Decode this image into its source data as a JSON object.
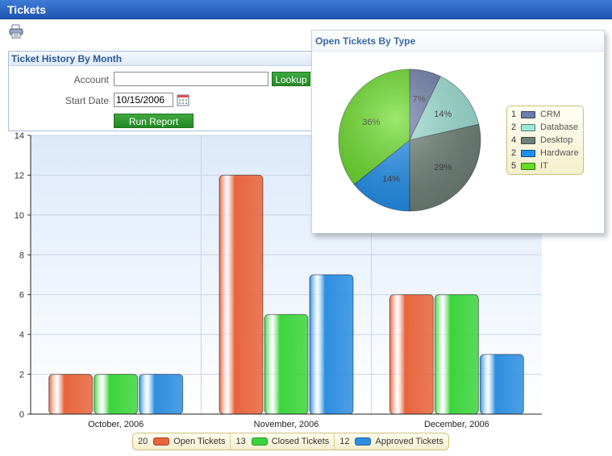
{
  "window": {
    "title": "Tickets"
  },
  "toolbar": {
    "print_icon": "printer-icon"
  },
  "history_panel": {
    "title": "Ticket History By Month",
    "account_label": "Account",
    "account_value": "",
    "lookup_label": "Lookup",
    "start_date_label": "Start Date",
    "start_date_value": "10/15/2006",
    "calendar_icon": "calendar-icon",
    "run_label": "Run Report"
  },
  "chart_data": [
    {
      "type": "bar",
      "categories": [
        "October, 2006",
        "November, 2006",
        "December, 2006"
      ],
      "series": [
        {
          "name": "Open Tickets",
          "values": [
            2,
            12,
            6
          ],
          "color": "#e8643c",
          "total": "20"
        },
        {
          "name": "Closed Tickets",
          "values": [
            2,
            5,
            6
          ],
          "color": "#3cd43c",
          "total": "13"
        },
        {
          "name": "Approved Tickets",
          "values": [
            2,
            7,
            3
          ],
          "color": "#2e8ee0",
          "total": "12"
        }
      ],
      "ylim": [
        0,
        14
      ],
      "yticks": [
        "0",
        "2",
        "4",
        "6",
        "8",
        "10",
        "12",
        "14"
      ],
      "grid": true,
      "legend_position": "bottom"
    },
    {
      "type": "pie",
      "title": "Open Tickets By Type",
      "slices": [
        {
          "label": "CRM",
          "count": "1",
          "value": 1,
          "pct": "7%",
          "color": "#6b7da8"
        },
        {
          "label": "Database",
          "count": "2",
          "value": 2,
          "pct": "14%",
          "color": "#9ee4d8"
        },
        {
          "label": "Desktop",
          "count": "4",
          "value": 4,
          "pct": "29%",
          "color": "#6f827a"
        },
        {
          "label": "Hardware",
          "count": "2",
          "value": 2,
          "pct": "14%",
          "color": "#1e90f0"
        },
        {
          "label": "IT",
          "count": "5",
          "value": 5,
          "pct": "36%",
          "color": "#66dd22"
        }
      ],
      "legend_position": "right"
    }
  ]
}
